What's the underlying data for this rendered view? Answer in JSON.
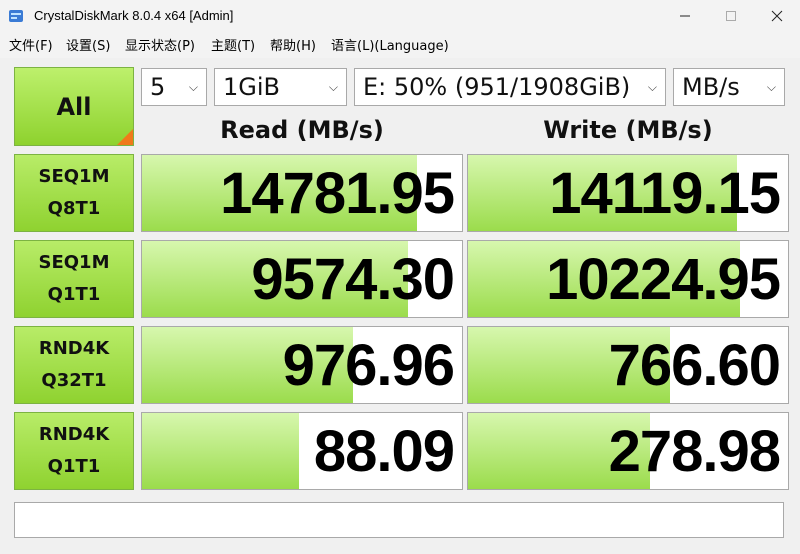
{
  "window": {
    "title": "CrystalDiskMark 8.0.4 x64 [Admin]"
  },
  "menu": [
    "文件(F)",
    "设置(S)",
    "显示状态(P)",
    "主题(T)",
    "帮助(H)",
    "语言(L)(Language)"
  ],
  "controls": {
    "all_label": "All",
    "count": "5",
    "size": "1GiB",
    "drive": "E: 50% (951/1908GiB)",
    "unit": "MB/s"
  },
  "headers": {
    "read": "Read (MB/s)",
    "write": "Write (MB/s)"
  },
  "tests": [
    {
      "line1": "SEQ1M",
      "line2": "Q8T1",
      "read": "14781.95",
      "write": "14119.15",
      "read_fill": 0.86,
      "write_fill": 0.84
    },
    {
      "line1": "SEQ1M",
      "line2": "Q1T1",
      "read": "9574.30",
      "write": "10224.95",
      "read_fill": 0.83,
      "write_fill": 0.85
    },
    {
      "line1": "RND4K",
      "line2": "Q32T1",
      "read": "976.96",
      "write": "766.60",
      "read_fill": 0.66,
      "write_fill": 0.63
    },
    {
      "line1": "RND4K",
      "line2": "Q1T1",
      "read": "88.09",
      "write": "278.98",
      "read_fill": 0.49,
      "write_fill": 0.57
    }
  ],
  "colors": {
    "accent_green": "#8ed22e",
    "corner_orange": "#f07a1a"
  }
}
